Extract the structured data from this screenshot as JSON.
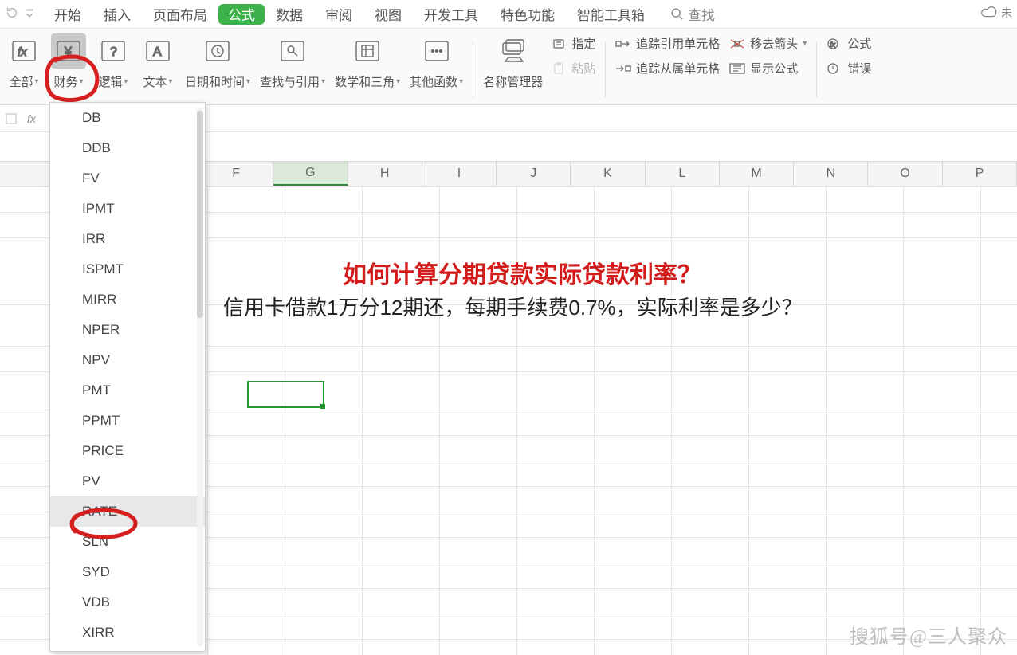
{
  "menu": {
    "tabs": [
      "开始",
      "插入",
      "页面布局",
      "公式",
      "数据",
      "审阅",
      "视图",
      "开发工具",
      "特色功能",
      "智能工具箱"
    ],
    "active_index": 3,
    "search": "查找",
    "cloud": "未"
  },
  "ribbon": {
    "groups": {
      "all": "全部",
      "financial": "财务",
      "logical": "逻辑",
      "text": "文本",
      "datetime": "日期和时间",
      "lookup": "查找与引用",
      "math": "数学和三角",
      "other": "其他函数",
      "name_mgr": "名称管理器",
      "assign": "指定",
      "paste": "粘贴",
      "trace_precedents": "追踪引用单元格",
      "trace_dependents": "追踪从属单元格",
      "remove_arrows": "移去箭头",
      "show_formulas": "显示公式",
      "formula_label": "公式",
      "error": "错误"
    }
  },
  "dropdown": {
    "items": [
      "DB",
      "DDB",
      "FV",
      "IPMT",
      "IRR",
      "ISPMT",
      "MIRR",
      "NPER",
      "NPV",
      "PMT",
      "PPMT",
      "PRICE",
      "PV",
      "RATE",
      "SLN",
      "SYD",
      "VDB",
      "XIRR"
    ],
    "hover_index": 13
  },
  "columns": [
    "F",
    "G",
    "H",
    "I",
    "J",
    "K",
    "L",
    "M",
    "N",
    "O",
    "P"
  ],
  "active_col_index": 1,
  "text": {
    "title": "如何计算分期贷款实际贷款利率？",
    "sub": "信用卡借款1万分12期还，每期手续费0.7%，实际利率是多少？"
  },
  "watermark": "搜狐号@三人聚众"
}
